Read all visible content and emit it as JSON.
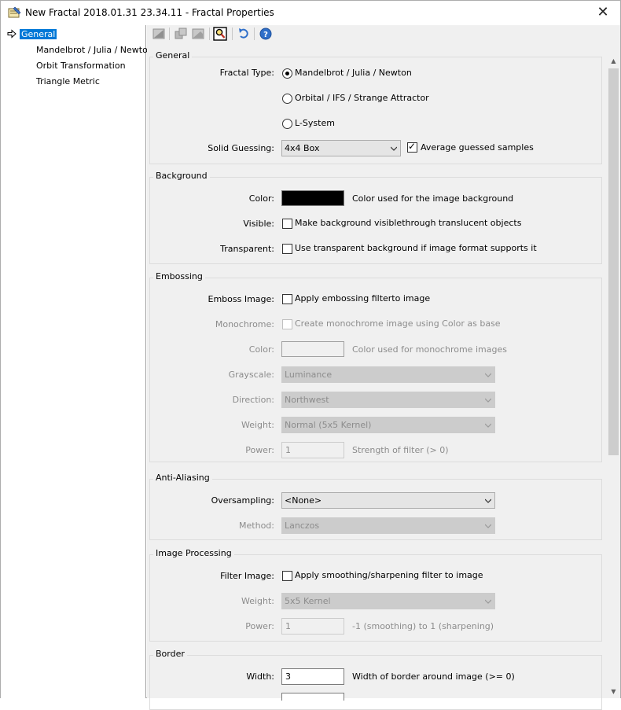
{
  "window": {
    "title": "New Fractal 2018.01.31 23.34.11 - Fractal Properties",
    "close_glyph": "✕"
  },
  "tree": {
    "items": [
      "General",
      "Mandelbrot / Julia / Newton",
      "Orbit Transformation",
      "Triangle Metric"
    ]
  },
  "groups": {
    "general": {
      "title": "General",
      "fractal_type_label": "Fractal Type:",
      "fractal_types": [
        "Mandelbrot / Julia / Newton",
        "Orbital / IFS / Strange Attractor",
        "L-System"
      ],
      "selected_fractal_type": "Mandelbrot / Julia / Newton",
      "solid_guessing_label": "Solid Guessing:",
      "solid_guessing_value": "4x4 Box",
      "average_samples_label": "Average guessed samples",
      "average_samples_checked": true
    },
    "background": {
      "title": "Background",
      "color_label": "Color:",
      "color_value": "#000000",
      "color_desc": "Color used for the image background",
      "visible_label": "Visible:",
      "visible_desc": "Make background visiblethrough translucent objects",
      "transparent_label": "Transparent:",
      "transparent_desc": "Use transparent background if image format supports it"
    },
    "embossing": {
      "title": "Embossing",
      "emboss_label": "Emboss Image:",
      "emboss_desc": "Apply embossing filterto image",
      "mono_label": "Monochrome:",
      "mono_desc": "Create monochrome image using Color as base",
      "color_label": "Color:",
      "color_desc": "Color used for monochrome images",
      "grayscale_label": "Grayscale:",
      "grayscale_value": "Luminance",
      "direction_label": "Direction:",
      "direction_value": "Northwest",
      "weight_label": "Weight:",
      "weight_value": "Normal (5x5 Kernel)",
      "power_label": "Power:",
      "power_value": "1",
      "power_desc": "Strength of filter (> 0)"
    },
    "antialiasing": {
      "title": "Anti-Aliasing",
      "oversampling_label": "Oversampling:",
      "oversampling_value": "<None>",
      "method_label": "Method:",
      "method_value": "Lanczos"
    },
    "imageprocessing": {
      "title": "Image Processing",
      "filter_label": "Filter Image:",
      "filter_desc": "Apply smoothing/sharpening filter to image",
      "weight_label": "Weight:",
      "weight_value": "5x5 Kernel",
      "power_label": "Power:",
      "power_value": "1",
      "power_desc": "-1 (smoothing) to 1 (sharpening)"
    },
    "border": {
      "title": "Border",
      "width_label": "Width:",
      "width_value": "3",
      "width_desc": "Width of border around image (>= 0)"
    }
  },
  "colors": {
    "selection": "#0078d7",
    "panel": "#f0f0f0",
    "disabled_text": "#8c8c8c"
  }
}
